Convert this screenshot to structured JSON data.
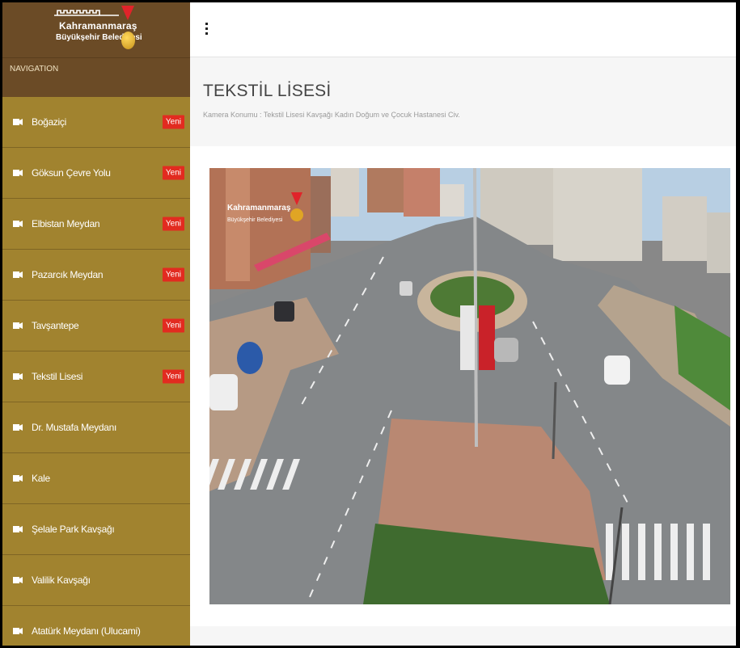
{
  "logo": {
    "line1": "Kahramanmaraş",
    "line2": "Büyükşehir Belediyesi"
  },
  "nav_heading": "NAVIGATION",
  "nav_items": [
    {
      "label": "Boğaziçi",
      "badge": "Yeni"
    },
    {
      "label": "Göksun Çevre Yolu",
      "badge": "Yeni"
    },
    {
      "label": "Elbistan Meydan",
      "badge": "Yeni"
    },
    {
      "label": "Pazarcık Meydan",
      "badge": "Yeni"
    },
    {
      "label": "Tavşantepe",
      "badge": "Yeni"
    },
    {
      "label": "Tekstil Lisesi",
      "badge": "Yeni"
    },
    {
      "label": "Dr. Mustafa Meydanı",
      "badge": ""
    },
    {
      "label": "Kale",
      "badge": ""
    },
    {
      "label": "Şelale Park Kavşağı",
      "badge": ""
    },
    {
      "label": "Valilik Kavşağı",
      "badge": ""
    },
    {
      "label": "Atatürk Meydanı (Ulucami)",
      "badge": ""
    }
  ],
  "page": {
    "title": "TEKSTİL LİSESİ",
    "camera_location": "Kamera Konumu : Tekstil Lisesi Kavşağı Kadın Doğum ve Çocuk Hastanesi Civ."
  },
  "camera": {
    "overlay_line1": "Kahramanmaraş",
    "overlay_line2": "Büyükşehir Belediyesi"
  },
  "colors": {
    "sidebar": "#a1832f",
    "sidebar_dark": "#6b4b26",
    "badge": "#e22b20"
  }
}
